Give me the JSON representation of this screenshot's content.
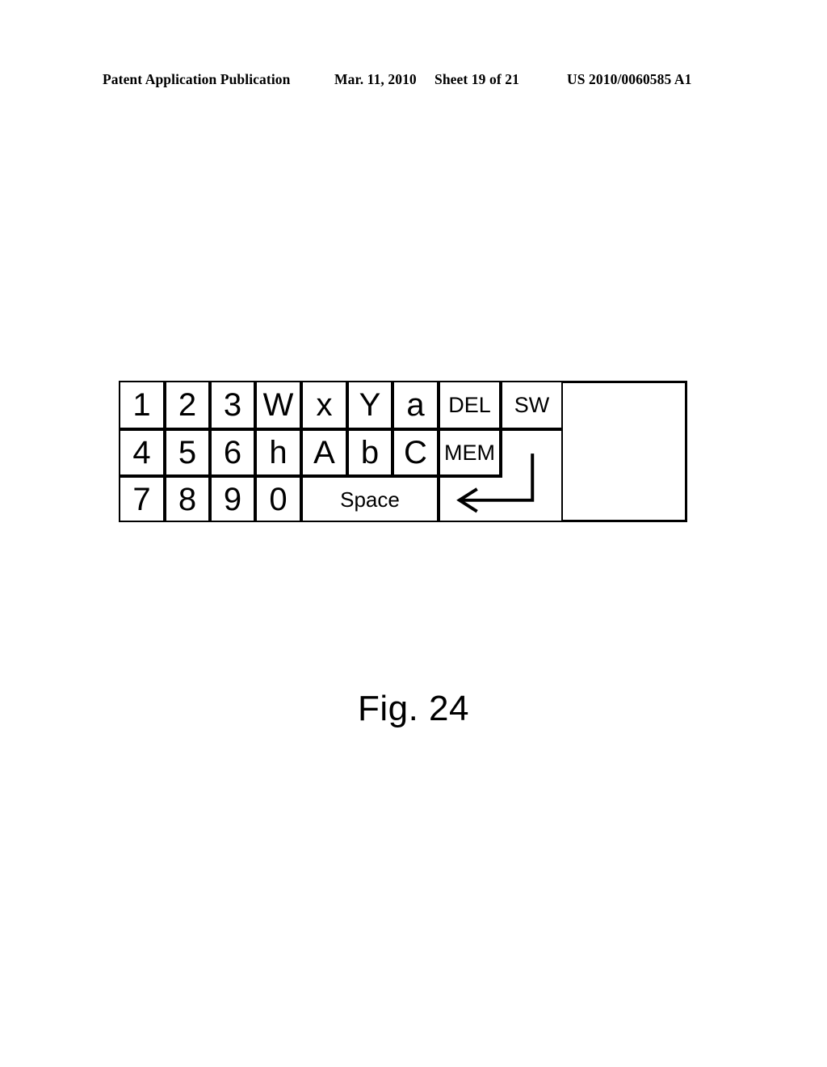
{
  "header": {
    "publication": "Patent Application Publication",
    "date": "Mar. 11, 2010",
    "sheet": "Sheet 19 of 21",
    "patent_number": "US 2010/0060585 A1"
  },
  "figure": {
    "caption": "Fig. 24",
    "keyboard": {
      "rows": [
        {
          "keys": [
            {
              "label": "1",
              "size": "big"
            },
            {
              "label": "2",
              "size": "big"
            },
            {
              "label": "3",
              "size": "big"
            },
            {
              "label": "W",
              "size": "big"
            },
            {
              "label": "x",
              "size": "big"
            },
            {
              "label": "Y",
              "size": "big"
            },
            {
              "label": "a",
              "size": "big"
            },
            {
              "label": "DEL",
              "size": "small"
            },
            {
              "label": "SW",
              "size": "small"
            }
          ]
        },
        {
          "keys": [
            {
              "label": "4",
              "size": "big"
            },
            {
              "label": "5",
              "size": "big"
            },
            {
              "label": "6",
              "size": "big"
            },
            {
              "label": "h",
              "size": "big"
            },
            {
              "label": "A",
              "size": "big"
            },
            {
              "label": "b",
              "size": "big"
            },
            {
              "label": "C",
              "size": "big"
            },
            {
              "label": "MEM",
              "size": "small"
            }
          ]
        },
        {
          "keys": [
            {
              "label": "7",
              "size": "big"
            },
            {
              "label": "8",
              "size": "big"
            },
            {
              "label": "9",
              "size": "big"
            },
            {
              "label": "0",
              "size": "big"
            },
            {
              "label": "Space",
              "size": "space"
            }
          ]
        }
      ],
      "enter_key": {
        "label": "",
        "icon": "return-arrow-icon"
      }
    }
  },
  "colors": {
    "ink": "#000000",
    "paper": "#ffffff"
  }
}
